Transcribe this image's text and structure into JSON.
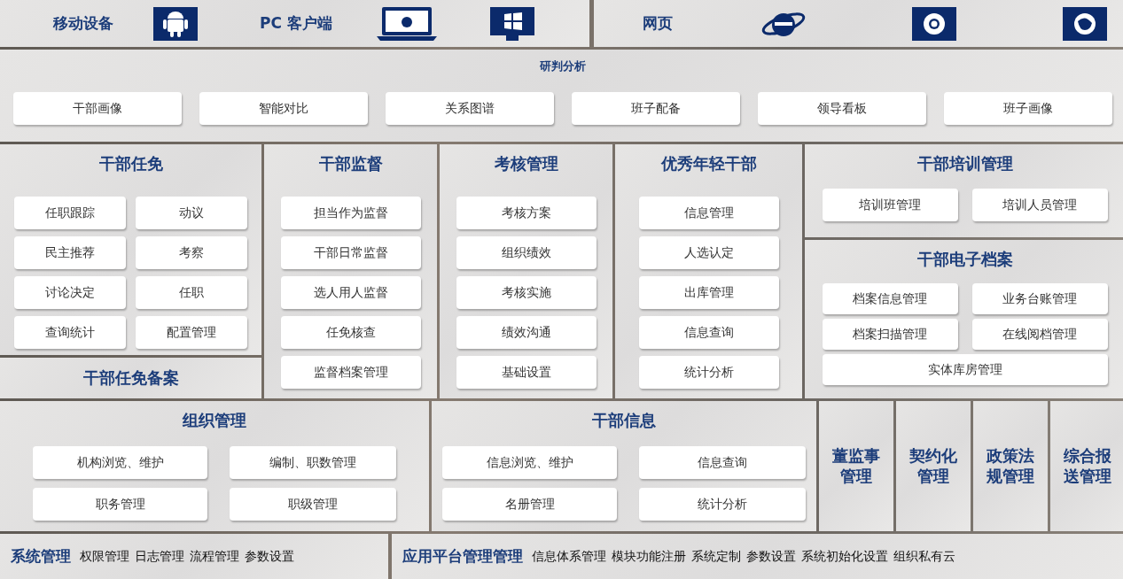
{
  "platforms": {
    "mobile": "移动设备",
    "pc": "PC 客户端",
    "web": "网页"
  },
  "analysis": {
    "title": "研判分析",
    "items": [
      "干部画像",
      "智能对比",
      "关系图谱",
      "班子配备",
      "领导看板",
      "班子画像"
    ]
  },
  "appointment": {
    "title": "干部任免",
    "items": [
      "任职跟踪",
      "动议",
      "民主推荐",
      "考察",
      "讨论决定",
      "任职",
      "查询统计",
      "配置管理"
    ]
  },
  "appointment_filing": {
    "title": "干部任免备案"
  },
  "supervision": {
    "title": "干部监督",
    "items": [
      "担当作为监督",
      "干部日常监督",
      "选人用人监督",
      "任免核查",
      "监督档案管理"
    ]
  },
  "assessment": {
    "title": "考核管理",
    "items": [
      "考核方案",
      "组织绩效",
      "考核实施",
      "绩效沟通",
      "基础设置"
    ]
  },
  "young_cadres": {
    "title": "优秀年轻干部",
    "items": [
      "信息管理",
      "人选认定",
      "出库管理",
      "信息查询",
      "统计分析"
    ]
  },
  "training": {
    "title": "干部培训管理",
    "items": [
      "培训班管理",
      "培训人员管理"
    ]
  },
  "archives": {
    "title": "干部电子档案",
    "items": [
      "档案信息管理",
      "业务台账管理",
      "档案扫描管理",
      "在线阅档管理",
      "实体库房管理"
    ]
  },
  "organization": {
    "title": "组织管理",
    "items": [
      "机构浏览、维护",
      "编制、职数管理",
      "职务管理",
      "职级管理"
    ]
  },
  "cadre_info": {
    "title": "干部信息",
    "items": [
      "信息浏览、维护",
      "信息查询",
      "名册管理",
      "统计分析"
    ]
  },
  "side_modules": [
    "董监事管理",
    "契约化管理",
    "政策法规管理",
    "综合报送管理"
  ],
  "system": {
    "title": "系统管理",
    "items": [
      "权限管理",
      "日志管理",
      "流程管理",
      "参数设置"
    ]
  },
  "platform": {
    "title": "应用平台管理管理",
    "items": [
      "信息体系管理",
      "模块功能注册",
      "系统定制",
      "参数设置",
      "系统初始化设置",
      "组织私有云"
    ]
  }
}
